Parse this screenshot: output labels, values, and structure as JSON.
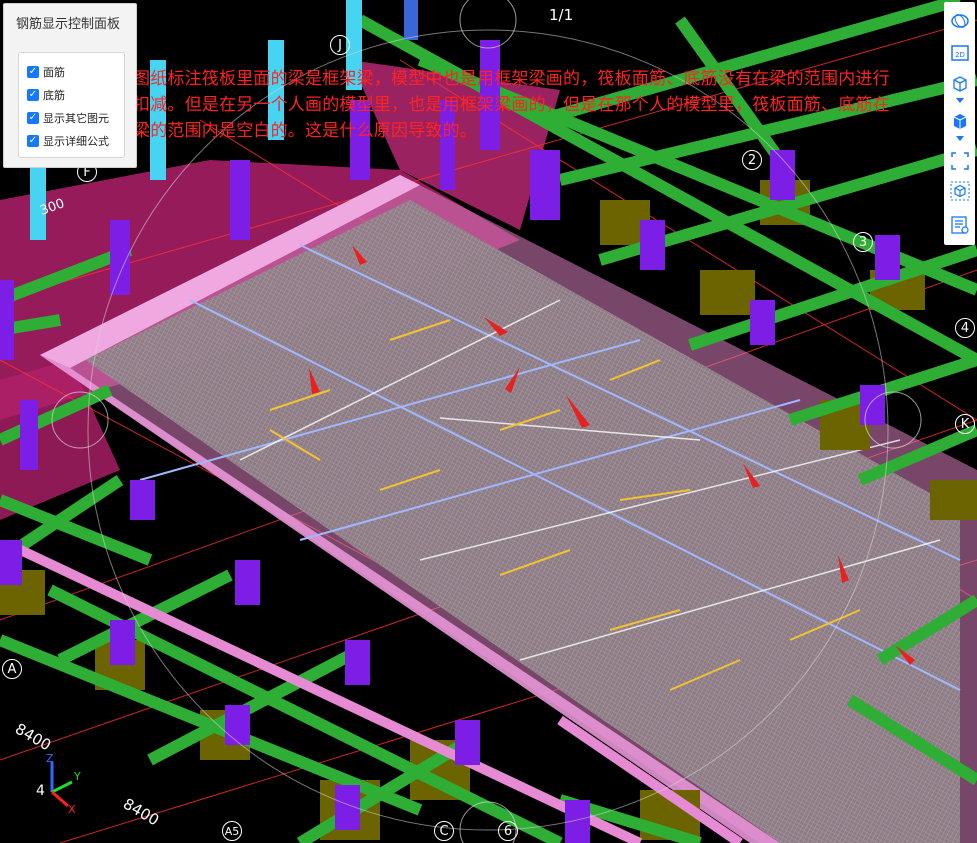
{
  "panel": {
    "title": "钢筋显示控制面板",
    "options": [
      {
        "label": "面筋",
        "checked": true
      },
      {
        "label": "底筋",
        "checked": true
      },
      {
        "label": "显示其它图元",
        "checked": true
      },
      {
        "label": "显示详细公式",
        "checked": true
      }
    ]
  },
  "annotation": {
    "text": "图纸标注筏板里面的梁是框架梁，模型中也是用框架梁画的，筏板面筋、底筋没有在梁的范围内进行扣减。但是在另一个人画的模型里，也是用框架梁画的，但是在那个人的模型里，筏板面筋、底筋在梁的范围内是空白的。这是什么原因导致的。"
  },
  "page_counter": "1/1",
  "dimensions": [
    "8400",
    "8400",
    "300"
  ],
  "axis_labels": {
    "grid_numbers": [
      "2",
      "3",
      "4",
      "6"
    ],
    "grid_letters": [
      "A",
      "A5",
      "C",
      "F",
      "J",
      "K"
    ],
    "coord_x": "X",
    "coord_y": "Y",
    "coord_z": "Z",
    "coord_num": "4"
  },
  "toolbar": {
    "icons": [
      "orbit-icon",
      "2d-view-icon",
      "cube-outline-icon",
      "cube-solid-icon",
      "fit-frame-icon",
      "cube-3d-icon",
      "settings-list-icon"
    ]
  },
  "colors": {
    "accent": "#1677ff",
    "annotation": "#ff2222",
    "beam_green": "#28b032",
    "column_purple": "#8a2be2",
    "slab_pink": "#f0a0d8"
  }
}
